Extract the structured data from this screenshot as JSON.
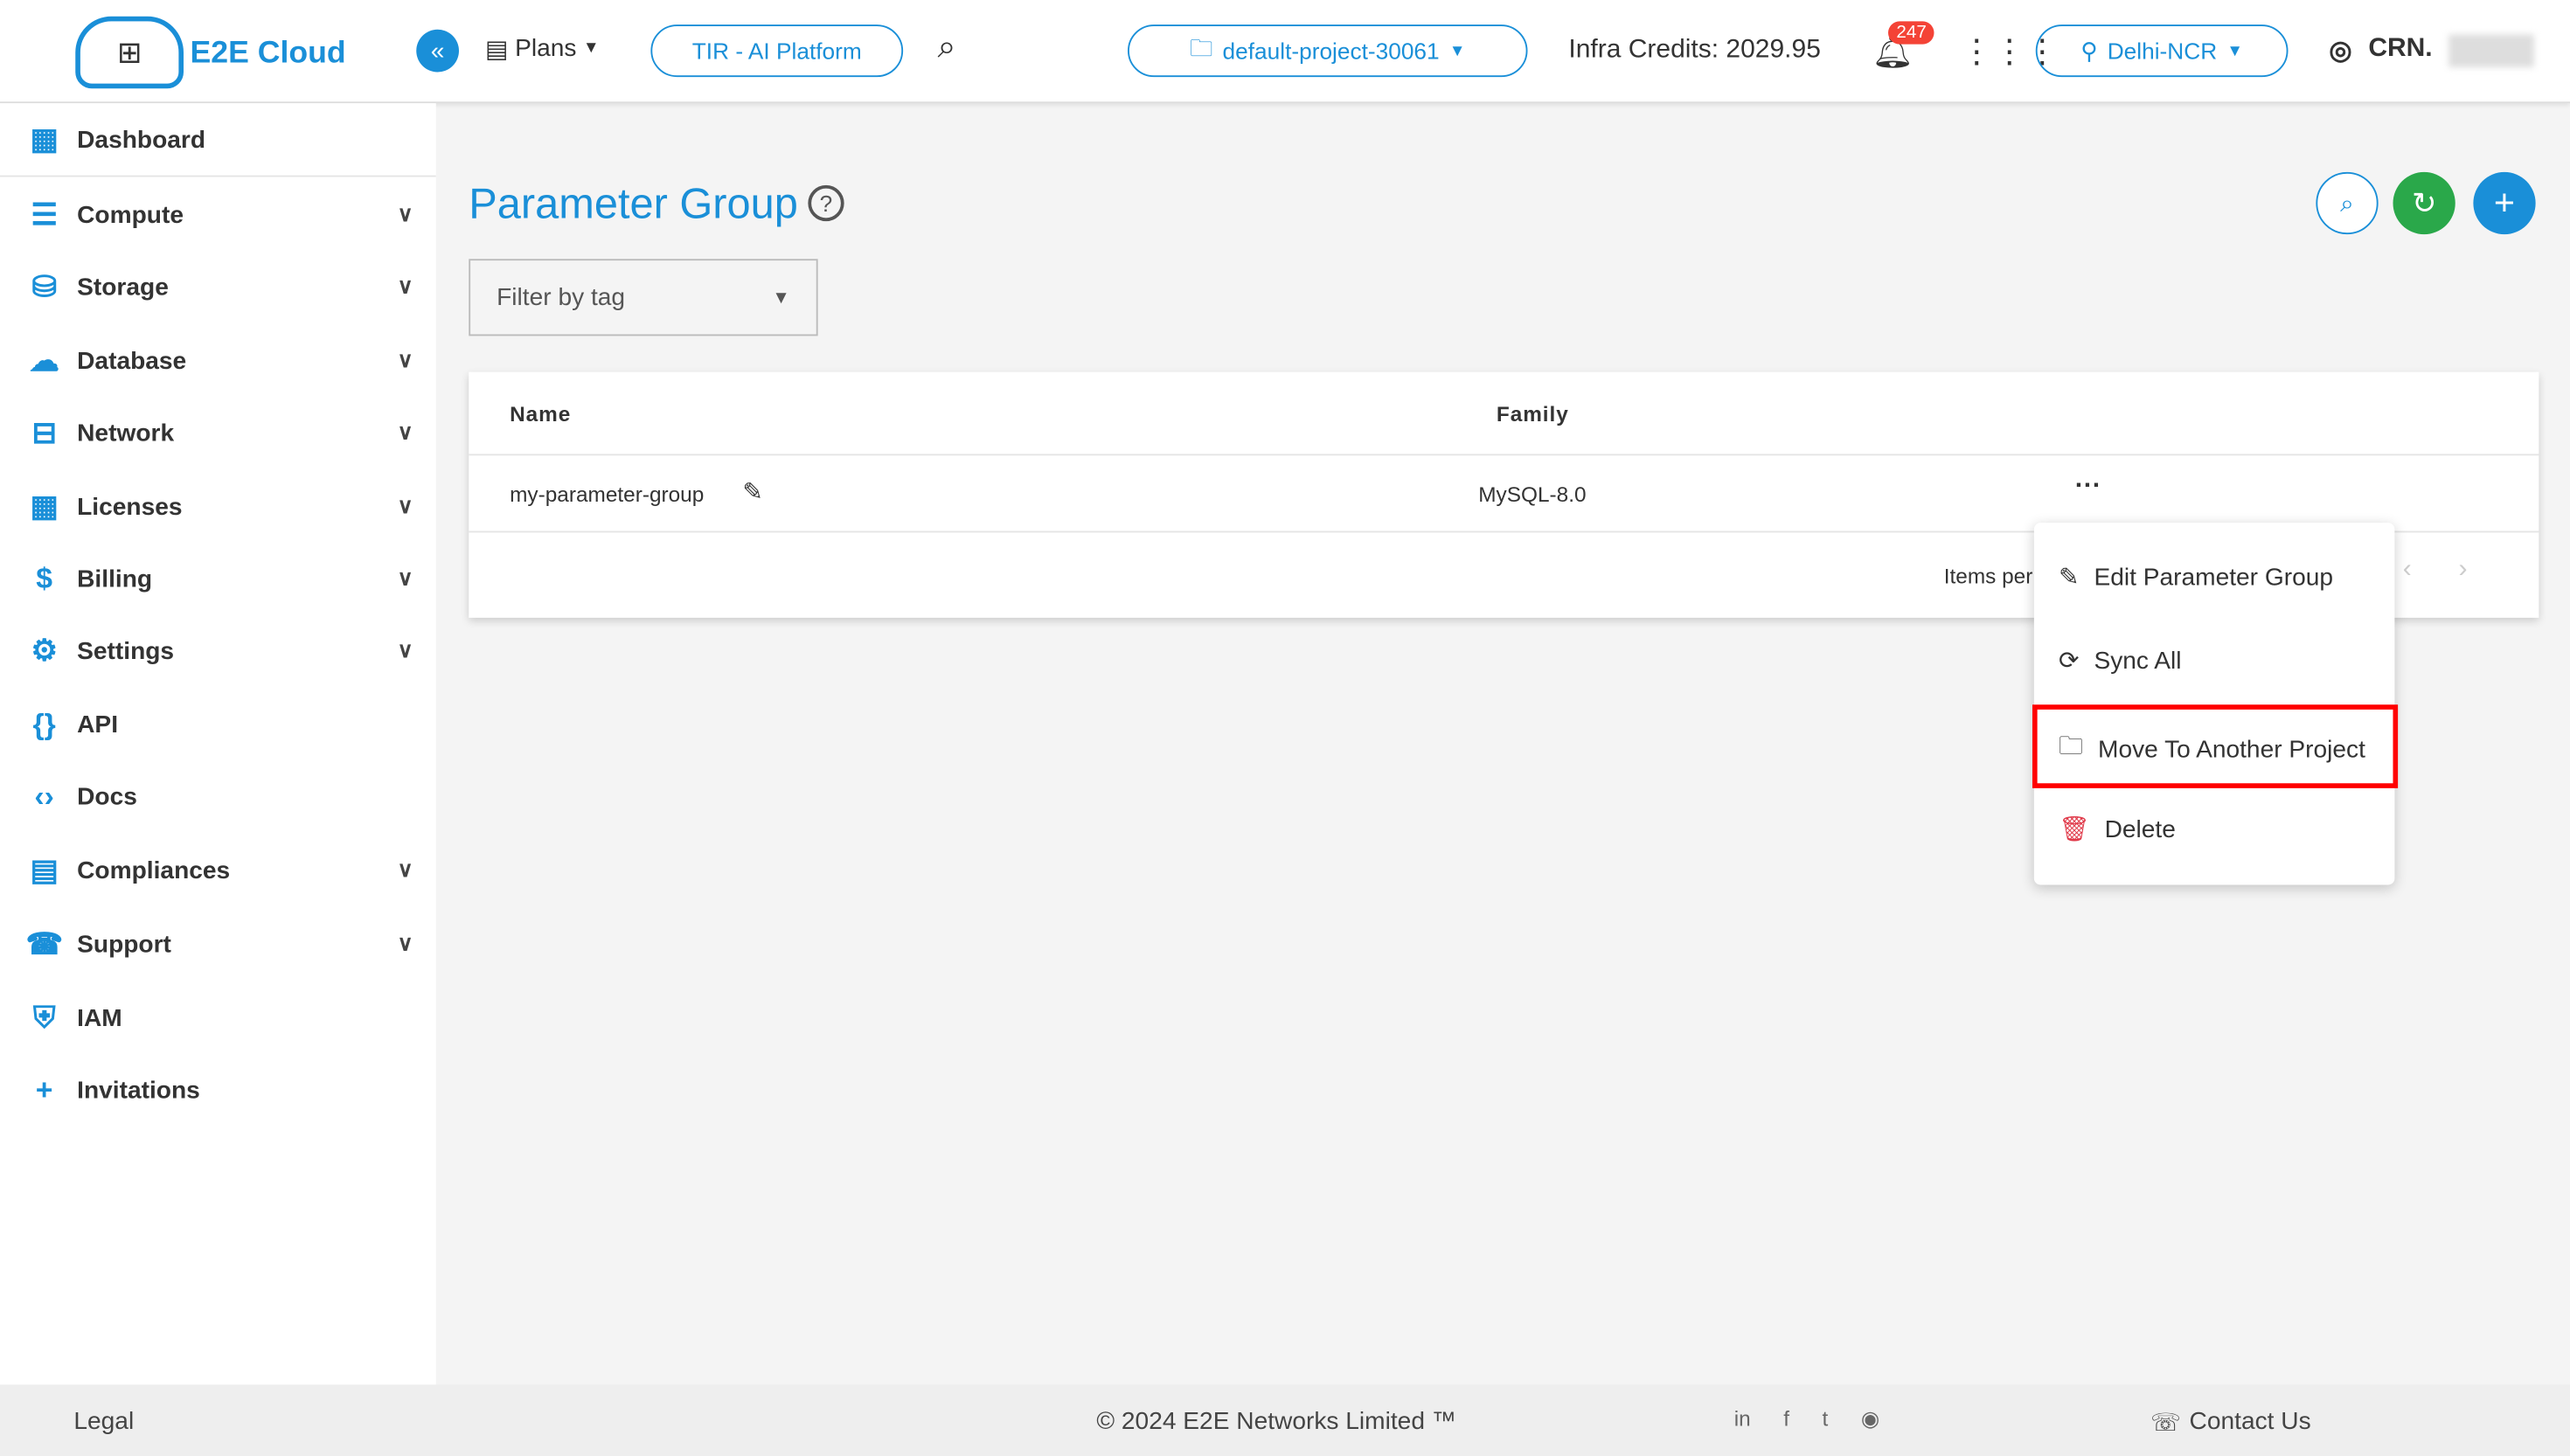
{
  "header": {
    "brand": "E2E Cloud",
    "plans": "Plans",
    "tir": "TIR - AI Platform",
    "project": "default-project-30061",
    "credits": "Infra Credits: 2029.95",
    "notifications": "247",
    "region": "Delhi-NCR",
    "user": "CRN."
  },
  "sidebar": {
    "items": [
      {
        "label": "Dashboard",
        "icon": "dashboard-icon",
        "expand": false
      },
      {
        "label": "Compute",
        "icon": "server-icon",
        "expand": true
      },
      {
        "label": "Storage",
        "icon": "database-icon",
        "expand": true
      },
      {
        "label": "Database",
        "icon": "cloud-db-icon",
        "expand": true
      },
      {
        "label": "Network",
        "icon": "network-icon",
        "expand": true
      },
      {
        "label": "Licenses",
        "icon": "grid-icon",
        "expand": true
      },
      {
        "label": "Billing",
        "icon": "billing-icon",
        "expand": true
      },
      {
        "label": "Settings",
        "icon": "gear-icon",
        "expand": true
      },
      {
        "label": "API",
        "icon": "braces-icon",
        "expand": false
      },
      {
        "label": "Docs",
        "icon": "code-icon",
        "expand": false
      },
      {
        "label": "Compliances",
        "icon": "document-icon",
        "expand": true
      },
      {
        "label": "Support",
        "icon": "support-icon",
        "expand": true
      },
      {
        "label": "IAM",
        "icon": "shield-user-icon",
        "expand": false
      },
      {
        "label": "Invitations",
        "icon": "add-user-icon",
        "expand": false
      }
    ]
  },
  "main": {
    "title": "Parameter Group",
    "filter_placeholder": "Filter by tag",
    "columns": [
      "Name",
      "Family"
    ],
    "rows": [
      {
        "name": "my-parameter-group",
        "family": "MySQL-8.0"
      }
    ],
    "items_per_page": "Items per"
  },
  "menu": {
    "items": [
      "Edit Parameter Group",
      "Sync All",
      "Move To Another Project",
      "Delete"
    ]
  },
  "footer": {
    "legal": "Legal",
    "copyright": "© 2024 E2E Networks Limited ™",
    "contact": "Contact Us"
  },
  "colors": {
    "accent": "#1a8fd8",
    "refresh": "#2aa84a",
    "highlight": "#ff0000",
    "badge": "#f44336"
  }
}
